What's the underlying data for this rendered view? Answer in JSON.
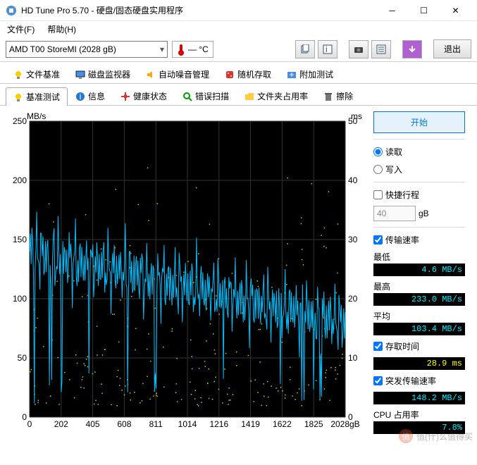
{
  "window": {
    "title": "HD Tune Pro 5.70 - 硬盘/固态硬盘实用程序"
  },
  "menu": {
    "file": "文件(F)",
    "help": "帮助(H)"
  },
  "toolbar": {
    "drive": "AMD    T00 StoreMI (2028 gB)",
    "temp": "— °C",
    "exit": "退出"
  },
  "tabs_row1": [
    {
      "icon": "bulb",
      "label": "文件基准"
    },
    {
      "icon": "monitor",
      "label": "磁盘监视器"
    },
    {
      "icon": "speaker",
      "label": "自动噪音管理"
    },
    {
      "icon": "dice",
      "label": "随机存取"
    },
    {
      "icon": "plus",
      "label": "附加测试"
    }
  ],
  "tabs_row2": [
    {
      "icon": "bulb",
      "label": "基准测试",
      "active": true
    },
    {
      "icon": "info",
      "label": "信息"
    },
    {
      "icon": "health",
      "label": "健康状态"
    },
    {
      "icon": "search",
      "label": "错误扫描"
    },
    {
      "icon": "folder",
      "label": "文件夹占用率"
    },
    {
      "icon": "trash",
      "label": "擦除"
    }
  ],
  "chart": {
    "unit_left": "MB/s",
    "unit_right": "ms",
    "yticks_left": [
      250,
      200,
      150,
      100,
      50,
      0
    ],
    "yticks_right": [
      50,
      40,
      30,
      20,
      10,
      0
    ],
    "xticks": [
      0,
      202,
      405,
      608,
      811,
      1014,
      1216,
      1419,
      1622,
      1825,
      "2028gB"
    ]
  },
  "side": {
    "start": "开始",
    "read": "读取",
    "write": "写入",
    "shortstroke": "快捷行程",
    "shortstroke_val": "40",
    "shortstroke_unit": "gB",
    "transfer_chk": "传输速率",
    "min_label": "最低",
    "min_val": "4.6 MB/s",
    "max_label": "最高",
    "max_val": "233.0 MB/s",
    "avg_label": "平均",
    "avg_val": "103.4 MB/s",
    "access_chk": "存取时间",
    "access_val": "28.9 ms",
    "burst_chk": "突发传输速率",
    "burst_val": "148.2 MB/s",
    "cpu_label": "CPU 占用率",
    "cpu_val": "7.8%"
  },
  "watermark": "值(什)么值得买",
  "chart_data": {
    "type": "line",
    "title": "",
    "xlabel": "gB",
    "ylabel_left": "MB/s",
    "ylabel_right": "ms",
    "xlim": [
      0,
      2028
    ],
    "ylim_left": [
      0,
      250
    ],
    "ylim_right": [
      0,
      50
    ],
    "series": [
      {
        "name": "transfer_rate_MBps",
        "axis": "left",
        "values_sample": [
          140,
          135,
          150,
          130,
          110,
          125,
          100,
          120,
          95,
          108,
          90,
          115,
          88,
          110,
          82,
          95,
          78,
          90,
          70,
          85
        ]
      },
      {
        "name": "access_time_ms",
        "axis": "right",
        "note": "scattered yellow dots, approx 5-45ms spread across range"
      }
    ],
    "stats": {
      "min": 4.6,
      "max": 233.0,
      "avg": 103.4,
      "access_ms": 28.9,
      "burst": 148.2,
      "cpu_pct": 7.8
    }
  }
}
